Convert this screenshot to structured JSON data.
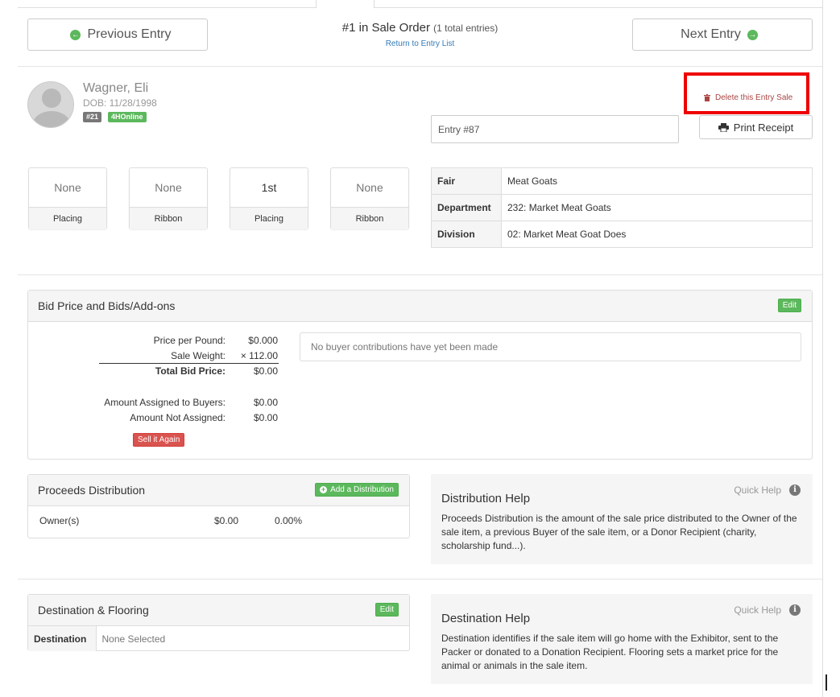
{
  "nav": {
    "prev_label": "Previous Entry",
    "next_label": "Next Entry",
    "order_title": "#1 in Sale Order",
    "order_count": "(1 total entries)",
    "return_link": "Return to Entry List"
  },
  "exhibitor": {
    "name": "Wagner, Eli",
    "dob": "DOB: 11/28/1998",
    "badge_number": "#21",
    "badge_source": "4HOnline"
  },
  "actions": {
    "delete_label": "Delete this Entry Sale",
    "print_label": "Print Receipt",
    "entry_field": "Entry #87"
  },
  "placings": [
    {
      "value": "None",
      "label": "Placing"
    },
    {
      "value": "None",
      "label": "Ribbon"
    },
    {
      "value": "1st",
      "label": "Placing"
    },
    {
      "value": "None",
      "label": "Ribbon"
    }
  ],
  "info_table": [
    {
      "key": "Fair",
      "value": "Meat Goats"
    },
    {
      "key": "Department",
      "value": "232: Market Meat Goats"
    },
    {
      "key": "Division",
      "value": "02: Market Meat Goat Does"
    }
  ],
  "bid": {
    "title": "Bid Price and Bids/Add-ons",
    "edit_label": "Edit",
    "price_per_pound_label": "Price per Pound:",
    "price_per_pound": "$0.000",
    "sale_weight_label": "Sale Weight:",
    "sale_weight": "× 112.00",
    "total_label": "Total Bid Price:",
    "total": "$0.00",
    "assigned_label": "Amount Assigned to Buyers:",
    "assigned": "$0.00",
    "not_assigned_label": "Amount Not Assigned:",
    "not_assigned": "$0.00",
    "sell_again_label": "Sell it Again",
    "contributions_text": "No buyer contributions have yet been made"
  },
  "proceeds": {
    "title": "Proceeds Distribution",
    "add_label": "Add a Distribution",
    "row_owner": "Owner(s)",
    "row_amount": "$0.00",
    "row_percent": "0.00%"
  },
  "distribution_help": {
    "title": "Distribution Help",
    "quick_help": "Quick Help",
    "text": "Proceeds Distribution is the amount of the sale price distributed to the Owner of the sale item, a previous Buyer of the sale item, or a Donor Recipient (charity, scholarship fund...)."
  },
  "destination": {
    "title": "Destination & Flooring",
    "edit_label": "Edit",
    "key": "Destination",
    "value": "None Selected"
  },
  "destination_help": {
    "title": "Destination Help",
    "quick_help": "Quick Help",
    "text": "Destination identifies if the sale item will go home with the Exhibitor, sent to the Packer or donated to a Donation Recipient. Flooring sets a market price for the animal or animals in the sale item."
  },
  "colors": {
    "green": "#5cb85c",
    "red": "#d9534f",
    "highlight": "#ee0000",
    "link": "#337ab7"
  }
}
